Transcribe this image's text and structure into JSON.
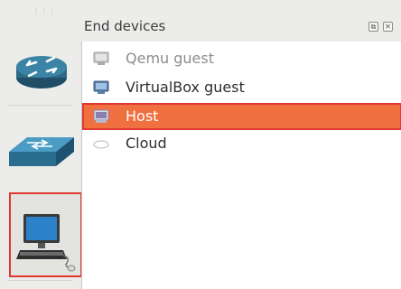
{
  "panel": {
    "title": "End devices",
    "float_glyph": "⧉",
    "close_glyph": "✕"
  },
  "sidebar": {
    "categories": [
      {
        "name": "router",
        "icon": "router-icon",
        "selected": false
      },
      {
        "name": "switch",
        "icon": "switch-icon",
        "selected": false
      },
      {
        "name": "end-devices",
        "icon": "computer-icon",
        "selected": true
      }
    ]
  },
  "devices": [
    {
      "label": "Qemu guest",
      "icon": "qemu-icon",
      "disabled": true
    },
    {
      "label": "VirtualBox guest",
      "icon": "virtualbox-icon",
      "disabled": false
    },
    {
      "label": "Host",
      "icon": "host-icon",
      "selected": true
    },
    {
      "label": "Cloud",
      "icon": "cloud-icon",
      "disabled": false
    }
  ],
  "colors": {
    "selection": "#f07040",
    "highlight_border": "#e0392f"
  }
}
